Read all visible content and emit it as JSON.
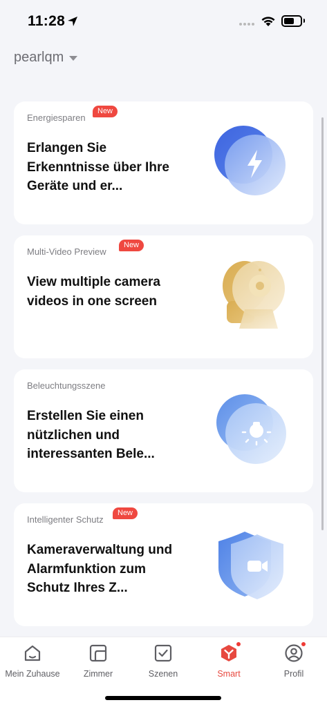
{
  "status_bar": {
    "time": "11:28",
    "icons": [
      "location-arrow-icon",
      "cellular-signal-icon",
      "wifi-icon",
      "battery-icon"
    ]
  },
  "header": {
    "home_name": "pearlqm",
    "dropdown_icon": "chevron-down-icon"
  },
  "cards": [
    {
      "label": "Energiesparen",
      "badge": "New",
      "title": "Erlangen Sie Erkenntnisse über Ihre Geräte und er...",
      "icon": "lightning-bolt-icon",
      "accent": "#4d78e6"
    },
    {
      "label": "Multi-Video Preview",
      "badge": "New",
      "title": "View multiple camera videos in one screen",
      "icon": "camera-icon",
      "accent": "#d9b15e"
    },
    {
      "label": "Beleuchtungsszene",
      "badge": "",
      "title": "Erstellen Sie einen nützlichen und interessanten Bele...",
      "icon": "light-bulb-icon",
      "accent": "#6a9aec"
    },
    {
      "label": "Intelligenter Schutz",
      "badge": "New",
      "title": "Kameraverwaltung und Alarmfunktion zum Schutz Ihres Z...",
      "icon": "shield-video-icon",
      "accent": "#5c8ee8"
    }
  ],
  "tab_bar": {
    "active": "Smart",
    "active_color": "#e7483f",
    "tabs": [
      {
        "label": "Mein Zuhause",
        "icon": "house-icon"
      },
      {
        "label": "Zimmer",
        "icon": "room-icon"
      },
      {
        "label": "Szenen",
        "icon": "checkbox-icon"
      },
      {
        "label": "Smart",
        "icon": "smart-cube-icon"
      },
      {
        "label": "Profil",
        "icon": "profile-icon"
      }
    ]
  }
}
